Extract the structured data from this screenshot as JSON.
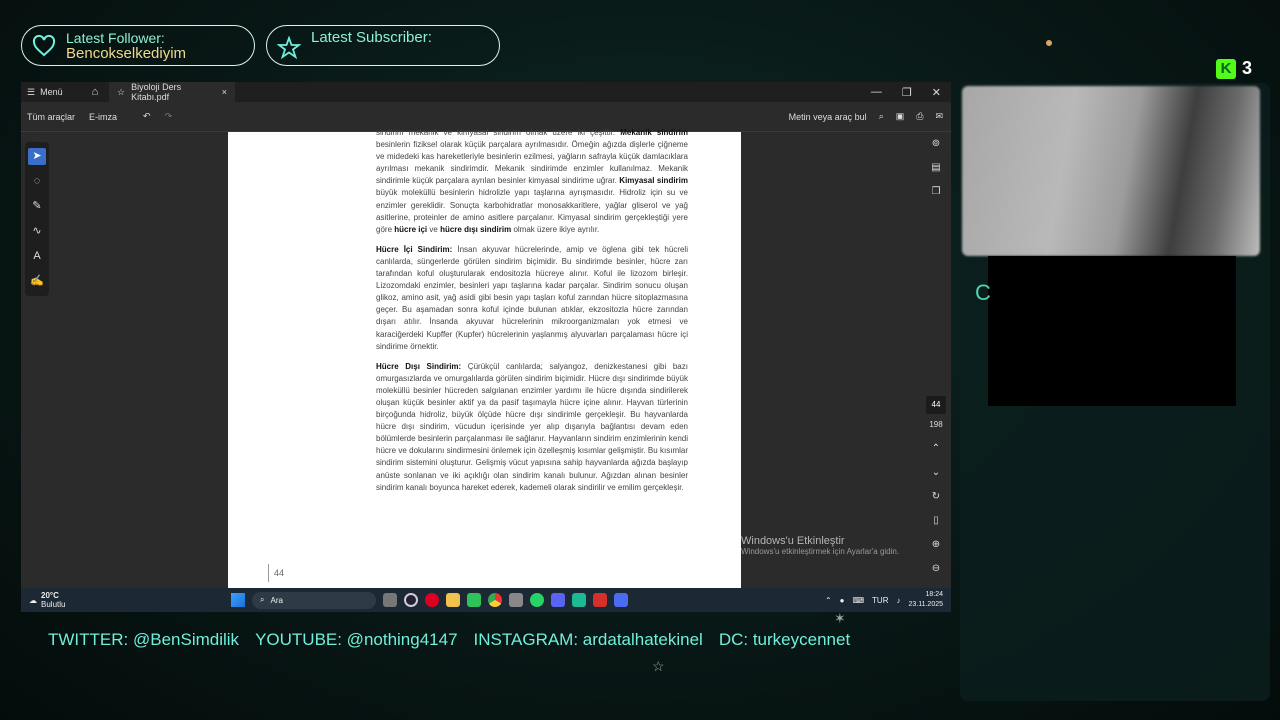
{
  "overlay": {
    "latest_follower_label": "Latest Follower:",
    "latest_follower_name": "Bencokselkediyim",
    "latest_subscriber_label": "Latest Subscriber:",
    "kick_count": "3"
  },
  "window": {
    "menu_label": "Menü",
    "tab_title": "Biyoloji Ders Kitabı.pdf",
    "tab_close": "×",
    "win_min": "—",
    "win_max": "❐",
    "win_close": "✕"
  },
  "toolbar": {
    "all_tools": "Tüm araçlar",
    "e_signature": "E-imza",
    "search_placeholder": "Metin veya araç bul"
  },
  "pdf": {
    "intro_lines": "sindirim mekanik ve kimyasal sindirim olmak üzere iki çeşittir.",
    "intro_bold": "Mekanik sindirim",
    "intro_rest": "besinlerin fiziksel olarak küçük parçalara ayrılmasıdır. Ömeğin ağızda dişlerle çiğneme ve midedeki kas hareketleriyle besinlerin ezilmesi, yağların safrayla küçük damlacıklara ayrılması mekanik sindirimdir. Mekanik sindirimde enzimler kullanılmaz. Mekanik sindirimle küçük parçalara ayrılan besinler kimyasal sindirime uğrar.",
    "intro_bold2": "Kimyasal sindirim",
    "intro_rest2": "büyük moleküllü besinlerin hidrolizle yapı taşlarına ayrışmasıdır. Hidroliz için su ve enzimler gereklidir. Sonuçta karbohidratlar monosakkaritlere, yağlar gliserol ve yağ asitlerine, proteinler de amino asitlere parçalanır. Kimyasal sindirim gerçekleştiği yere göre",
    "intro_bold3": "hücre içi",
    "intro_and": "ve",
    "intro_bold4": "hücre dışı sindirim",
    "intro_end": "olmak üzere ikiye ayrılır.",
    "p2_bold": "Hücre İçi Sindirim:",
    "p2_text": "İnsan akyuvar hücrelerinde, amip ve öglena gibi tek hücreli canlılarda, süngerlerde görülen sindirim biçimidir. Bu sindirimde besinler, hücre zarı tarafından koful oluşturularak endositozla hücreye alınır. Koful ile lizozom birleşir. Lizozomdaki enzimler, besinleri yapı taşlarına kadar parçalar. Sindirim sonucu oluşan glikoz, amino asit, yağ asidi gibi besin yapı taşları koful zarından hücre sitoplazmasına geçer. Bu aşamadan sonra koful içinde bulunan atıklar, ekzositozla hücre zarından dışarı atılır. İnsanda akyuvar hücrelerinin mikroorganizmaları yok etmesi ve karaciğerdeki Kupffer (Kupfer) hücrelerinin yaşlanmış alyuvarları parçalaması hücre içi sindirime örnektir.",
    "p3_bold": "Hücre Dışı Sindirim:",
    "p3_text": "Çürükçül canlılarda; salyangoz, denizkestanesi gibi bazı omurgasızlarda ve omurgalılarda görülen sindirim biçimidir. Hücre dışı sindirimde büyük moleküllü besinler hücreden salgılanan enzimler yardımı ile hücre dışında sindirilerek oluşan küçük besinler aktif ya da pasif taşımayla hücre içine alınır. Hayvan türlerinin birçoğunda hidroliz, büyük ölçüde hücre dışı sindirimle gerçekleşir. Bu hayvanlarda hücre dışı sindirim, vücudun içerisinde yer alıp dışarıyla bağlantısı devam eden bölümlerde besinlerin parçalanması ile sağlanır. Hayvanların sindirim enzimlerinin kendi hücre ve dokularını sindirmesini önlemek için özelleşmiş kısımlar gelişmiştir. Bu kısımlar sindirim sistemini oluşturur. Gelişmiş vücut yapısına sahip hayvanlarda ağızda başlayıp anüste sonlanan ve iki açıklığı olan sindirim kanalı bulunur. Ağızdan alınan besinler sindirim kanalı boyunca hareket ederek, kademeli olarak sindirilir ve emilim gerçekleşir.",
    "page_number": "44",
    "current_page": "44",
    "total_pages": "198"
  },
  "watermark": {
    "title": "Windows'u Etkinleştir",
    "subtitle": "Windows'u etkinleştirmek için Ayarlar'a gidin."
  },
  "taskbar": {
    "temperature": "20°C",
    "weather_desc": "Bulutlu",
    "search_label": "Ara",
    "language": "TUR",
    "time": "18:24",
    "date": "23.11.2025"
  },
  "socials": {
    "twitter": "TWITTER: @BenSimdilik",
    "youtube": "YOUTUBE: @nothing4147",
    "instagram": "INSTAGRAM: ardatalhatekinel",
    "discord": "DC: turkeycennet"
  },
  "colors": {
    "accent": "#6ff0dc",
    "follower_name": "#f0d98c",
    "kick_green": "#53fc18",
    "acrobat_blue": "#3b6ec9"
  }
}
